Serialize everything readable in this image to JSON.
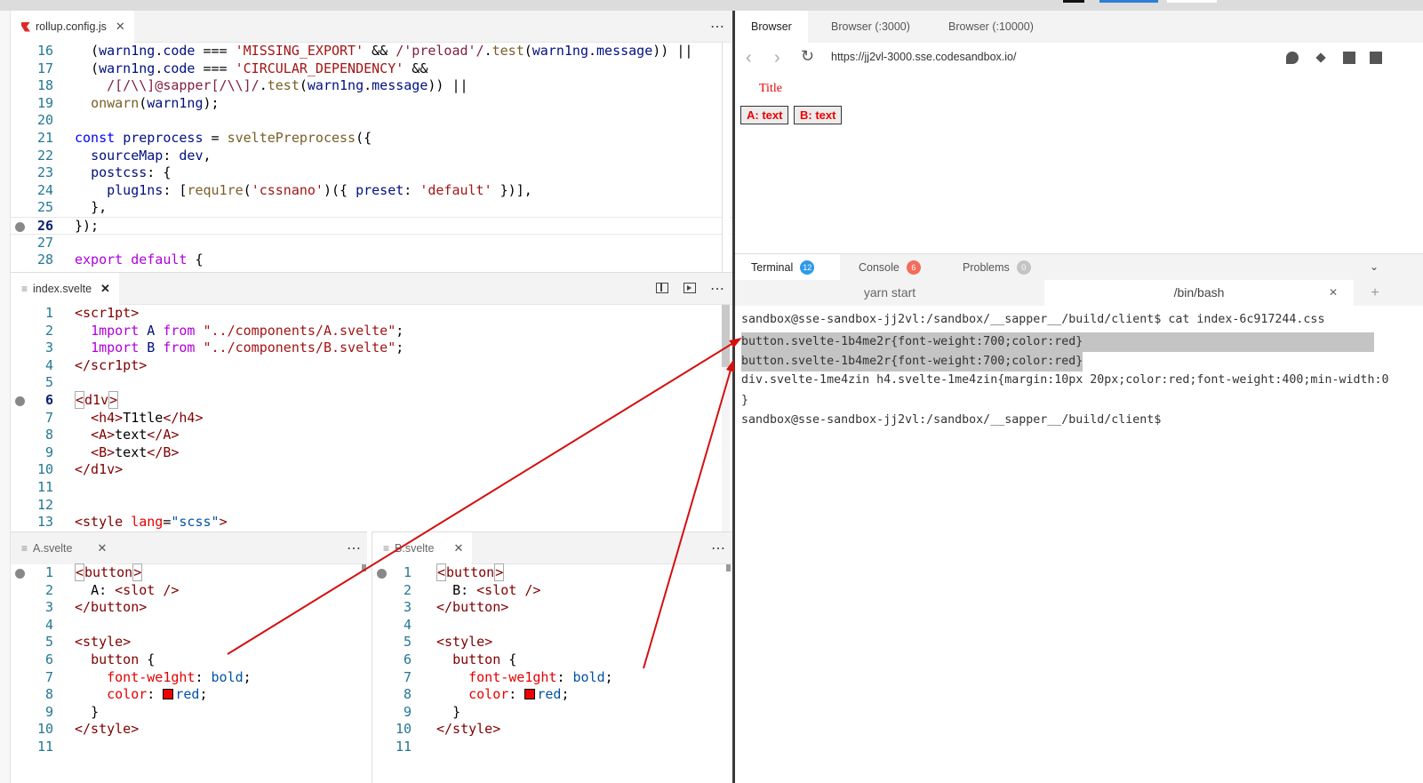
{
  "colors": {
    "accent_red": "#e00000",
    "terminal_badge": "#2d9ae8",
    "console_badge": "#f26d5b",
    "problems_badge": "#c4c4c4"
  },
  "rollup_pane": {
    "tab_label": "rollup.config.js",
    "file_icon": "rollup-file-icon",
    "lines": [
      {
        "n": "16",
        "html": "  <span class=\"plain\">(</span><span class=\"var\">warn1ng</span><span class=\"plain\">.</span><span class=\"var\">code</span> <span class=\"plain\">===</span> <span class=\"str\">'MISSING_EXPORT'</span> <span class=\"plain\">&amp;&amp;</span> <span class=\"regex\">/'preload'/</span><span class=\"plain\">.</span><span class=\"fn\">test</span><span class=\"plain\">(</span><span class=\"var\">warn1ng</span><span class=\"plain\">.</span><span class=\"var\">message</span><span class=\"plain\">)) ||</span>"
      },
      {
        "n": "17",
        "html": "  <span class=\"plain\">(</span><span class=\"var\">warn1ng</span><span class=\"plain\">.</span><span class=\"var\">code</span> <span class=\"plain\">===</span> <span class=\"str\">'CIRCULAR_DEPENDENCY'</span> <span class=\"plain\">&amp;&amp;</span>"
      },
      {
        "n": "18",
        "html": "    <span class=\"regex\">/[/\\\\]@sapper[/\\\\]/</span><span class=\"plain\">.</span><span class=\"fn\">test</span><span class=\"plain\">(</span><span class=\"var\">warn1ng</span><span class=\"plain\">.</span><span class=\"var\">message</span><span class=\"plain\">)) ||</span>"
      },
      {
        "n": "19",
        "html": "  <span class=\"fn\">onwarn</span><span class=\"plain\">(</span><span class=\"var\">warn1ng</span><span class=\"plain\">);</span>"
      },
      {
        "n": "20",
        "html": ""
      },
      {
        "n": "21",
        "html": "<span class=\"kb\">const</span> <span class=\"var\">preprocess</span> <span class=\"plain\">=</span> <span class=\"fn\">sveltePreprocess</span><span class=\"plain\">({</span>"
      },
      {
        "n": "22",
        "html": "  <span class=\"var\">sourceMap</span><span class=\"plain\">:</span> <span class=\"var\">dev</span><span class=\"plain\">,</span>"
      },
      {
        "n": "23",
        "html": "  <span class=\"var\">postcss</span><span class=\"plain\">: {</span>"
      },
      {
        "n": "24",
        "html": "    <span class=\"var\">plug1ns</span><span class=\"plain\">: [</span><span class=\"fn\">requ1re</span><span class=\"plain\">(</span><span class=\"str\">'cssnano'</span><span class=\"plain\">)({</span> <span class=\"var\">preset</span><span class=\"plain\">:</span> <span class=\"str\">'default'</span> <span class=\"plain\">})],</span>"
      },
      {
        "n": "25",
        "html": "  <span class=\"plain\">},</span>"
      },
      {
        "n": "26",
        "html": "<span class=\"plain\">});</span>",
        "cur": true,
        "mark": true
      },
      {
        "n": "27",
        "html": ""
      },
      {
        "n": "28",
        "html": "<span class=\"kw\">export</span> <span class=\"kw\">default</span> <span class=\"plain\">{</span>"
      }
    ]
  },
  "index_pane": {
    "tab_label": "index.svelte",
    "lines": [
      {
        "n": "1",
        "html": "<span class=\"tag\">&lt;scr1pt&gt;</span>"
      },
      {
        "n": "2",
        "html": "  <span class=\"kw\">1mport</span> <span class=\"var\">A</span> <span class=\"kw\">from</span> <span class=\"str\">\"../components/A.svelte\"</span><span class=\"plain\">;</span>"
      },
      {
        "n": "3",
        "html": "  <span class=\"kw\">1mport</span> <span class=\"var\">B</span> <span class=\"kw\">from</span> <span class=\"str\">\"../components/B.svelte\"</span><span class=\"plain\">;</span>"
      },
      {
        "n": "4",
        "html": "<span class=\"tag\">&lt;/scr1pt&gt;</span>"
      },
      {
        "n": "5",
        "html": ""
      },
      {
        "n": "6",
        "html": "<span class=\"tag tagbox\">&lt;</span><span class=\"tag\">d1v</span><span class=\"tag tagbox\">&gt;</span>",
        "cur": true,
        "mark": true
      },
      {
        "n": "7",
        "html": "  <span class=\"tag\">&lt;h4&gt;</span><span class=\"plain\">T1tle</span><span class=\"tag\">&lt;/h4&gt;</span>"
      },
      {
        "n": "8",
        "html": "  <span class=\"tag\">&lt;A&gt;</span><span class=\"plain\">text</span><span class=\"tag\">&lt;/A&gt;</span>"
      },
      {
        "n": "9",
        "html": "  <span class=\"tag\">&lt;B&gt;</span><span class=\"plain\">text</span><span class=\"tag\">&lt;/B&gt;</span>"
      },
      {
        "n": "10",
        "html": "<span class=\"tag\">&lt;/d1v&gt;</span>"
      },
      {
        "n": "11",
        "html": ""
      },
      {
        "n": "12",
        "html": ""
      },
      {
        "n": "13",
        "html": "<span class=\"tag\">&lt;style</span> <span class=\"prop\">lang</span><span class=\"plain\">=</span><span class=\"val\">\"scss\"</span><span class=\"tag\">&gt;</span>"
      }
    ]
  },
  "a_pane": {
    "tab_label": "A.svelte",
    "lines": [
      {
        "n": "1",
        "html": "<span class=\"tag tagbox\">&lt;</span><span class=\"tag\">button</span><span class=\"tag tagbox\">&gt;</span>",
        "mark": true
      },
      {
        "n": "2",
        "html": "  <span class=\"plain\">A:</span> <span class=\"tag\">&lt;slot /&gt;</span>"
      },
      {
        "n": "3",
        "html": "<span class=\"tag\">&lt;/button&gt;</span>"
      },
      {
        "n": "4",
        "html": ""
      },
      {
        "n": "5",
        "html": "<span class=\"tag\">&lt;style&gt;</span>"
      },
      {
        "n": "6",
        "html": "  <span class=\"tag\">button</span> <span class=\"plain\">{</span>"
      },
      {
        "n": "7",
        "html": "    <span class=\"prop\">font-we1ght</span><span class=\"plain\">:</span> <span class=\"val\">bold</span><span class=\"plain\">;</span>"
      },
      {
        "n": "8",
        "html": "    <span class=\"prop\">color</span><span class=\"plain\">:</span> <span class=\"sq\"></span><span class=\"val\">red</span><span class=\"plain\">;</span>"
      },
      {
        "n": "9",
        "html": "  <span class=\"plain\">}</span>"
      },
      {
        "n": "10",
        "html": "<span class=\"tag\">&lt;/style&gt;</span>"
      },
      {
        "n": "11",
        "html": ""
      }
    ]
  },
  "b_pane": {
    "tab_label": "B.svelte",
    "lines": [
      {
        "n": "1",
        "html": "<span class=\"tag tagbox\">&lt;</span><span class=\"tag\">button</span><span class=\"tag tagbox\">&gt;</span>",
        "mark": true
      },
      {
        "n": "2",
        "html": "  <span class=\"plain\">B:</span> <span class=\"tag\">&lt;slot /&gt;</span>"
      },
      {
        "n": "3",
        "html": "<span class=\"tag\">&lt;/button&gt;</span>"
      },
      {
        "n": "4",
        "html": ""
      },
      {
        "n": "5",
        "html": "<span class=\"tag\">&lt;style&gt;</span>"
      },
      {
        "n": "6",
        "html": "  <span class=\"tag\">button</span> <span class=\"plain\">{</span>"
      },
      {
        "n": "7",
        "html": "    <span class=\"prop\">font-we1ght</span><span class=\"plain\">:</span> <span class=\"val\">bold</span><span class=\"plain\">;</span>"
      },
      {
        "n": "8",
        "html": "    <span class=\"prop\">color</span><span class=\"plain\">:</span> <span class=\"sq\"></span><span class=\"val\">red</span><span class=\"plain\">;</span>"
      },
      {
        "n": "9",
        "html": "  <span class=\"plain\">}</span>"
      },
      {
        "n": "10",
        "html": "<span class=\"tag\">&lt;/style&gt;</span>"
      },
      {
        "n": "11",
        "html": ""
      }
    ]
  },
  "browser": {
    "tabs": [
      "Browser",
      "Browser (:3000)",
      "Browser (:10000)"
    ],
    "url": "https://jj2vl-3000.sse.codesandbox.io/",
    "preview_title": "Title",
    "button_a": "A: text",
    "button_b": "B: text"
  },
  "terminal_panel": {
    "tabs": [
      {
        "label": "Terminal",
        "badge": "12"
      },
      {
        "label": "Console",
        "badge": "6"
      },
      {
        "label": "Problems",
        "badge": "0"
      }
    ],
    "subtabs": [
      "yarn start",
      "/bin/bash"
    ],
    "add_label": "+",
    "lines": [
      "sandbox@sse-sandbox-jj2vl:/sandbox/__sapper__/build/client$ cat index-6c917244.css",
      "button.svelte-1b4me2r{font-weight:700;color:red}",
      "button.svelte-1b4me2r{font-weight:700;color:red}",
      "div.svelte-1me4zin h4.svelte-1me4zin{margin:10px 20px;color:red;font-weight:400;min-width:0",
      "}",
      "sandbox@sse-sandbox-jj2vl:/sandbox/__sapper__/build/client$"
    ]
  }
}
